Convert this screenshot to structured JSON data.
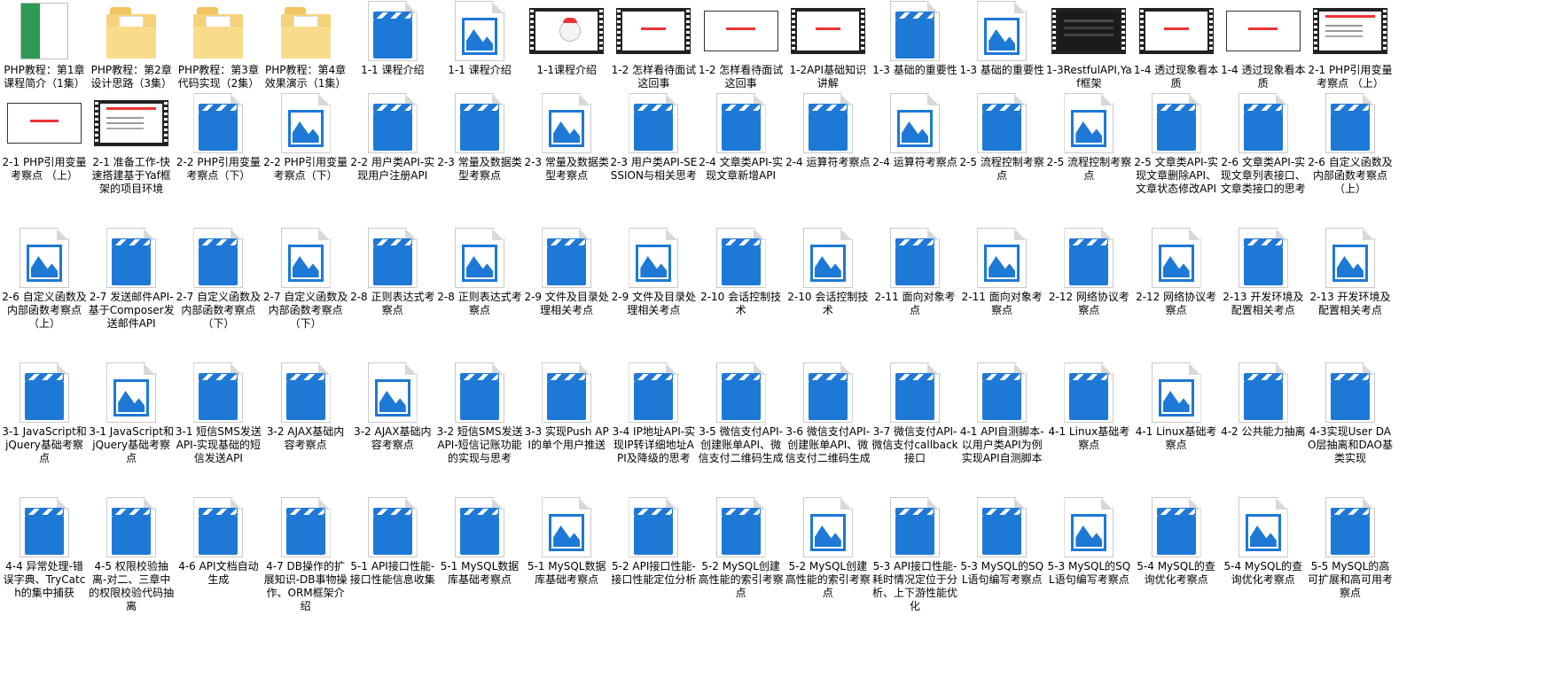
{
  "items": [
    {
      "label": "PHP教程：第1章课程简介（1集）",
      "kind": "book"
    },
    {
      "label": "PHP教程：第2章设计思路（3集）",
      "kind": "folder"
    },
    {
      "label": "PHP教程：第3章代码实现（2集）",
      "kind": "folder"
    },
    {
      "label": "PHP教程：第4章效果演示（1集）",
      "kind": "folder"
    },
    {
      "label": "1-1 课程介绍",
      "kind": "video"
    },
    {
      "label": "1-1 课程介绍",
      "kind": "image"
    },
    {
      "label": "1-1课程介绍",
      "kind": "film-mascot"
    },
    {
      "label": "1-2 怎样看待面试这回事",
      "kind": "film-red"
    },
    {
      "label": "1-2 怎样看待面试这回事",
      "kind": "slide-red"
    },
    {
      "label": "1-2API基础知识讲解",
      "kind": "film-red"
    },
    {
      "label": "1-3 基础的重要性",
      "kind": "video"
    },
    {
      "label": "1-3 基础的重要性",
      "kind": "image"
    },
    {
      "label": "1-3RestfulAPI,Yaf框架",
      "kind": "film-dark"
    },
    {
      "label": "1-4 透过现象看本质",
      "kind": "film-red"
    },
    {
      "label": "1-4 透过现象看本质",
      "kind": "slide-red"
    },
    {
      "label": "2-1 PHP引用变量考察点 （上）",
      "kind": "film-doc"
    },
    {
      "label": "2-1 PHP引用变量考察点 （上）",
      "kind": "slide-red"
    },
    {
      "label": "2-1 准备工作-快速搭建基于Yaf框架的项目环境",
      "kind": "film-doc"
    },
    {
      "label": "2-2 PHP引用变量考察点（下）",
      "kind": "video"
    },
    {
      "label": "2-2 PHP引用变量考察点（下）",
      "kind": "image"
    },
    {
      "label": "2-2 用户类API-实现用户注册API",
      "kind": "video"
    },
    {
      "label": "2-3 常量及数据类型考察点",
      "kind": "video"
    },
    {
      "label": "2-3 常量及数据类型考察点",
      "kind": "image"
    },
    {
      "label": "2-3 用户类API-SESSION与相关思考",
      "kind": "video"
    },
    {
      "label": "2-4 文章类API-实现文章新增API",
      "kind": "video"
    },
    {
      "label": "2-4 运算符考察点",
      "kind": "video"
    },
    {
      "label": "2-4 运算符考察点",
      "kind": "image"
    },
    {
      "label": "2-5 流程控制考察点",
      "kind": "video"
    },
    {
      "label": "2-5 流程控制考察点",
      "kind": "image"
    },
    {
      "label": "2-5 文章类API-实现文章删除API、文章状态修改API",
      "kind": "video"
    },
    {
      "label": "2-6 文章类API-实现文章列表接口、文章类接口的思考",
      "kind": "video"
    },
    {
      "label": "2-6 自定义函数及内部函数考察点（上）",
      "kind": "video"
    },
    {
      "label": "2-6 自定义函数及内部函数考察点（上）",
      "kind": "image"
    },
    {
      "label": "2-7 发送邮件API-基于Composer发送邮件API",
      "kind": "video"
    },
    {
      "label": "2-7 自定义函数及内部函数考察点（下）",
      "kind": "video"
    },
    {
      "label": "2-7 自定义函数及内部函数考察点（下）",
      "kind": "image"
    },
    {
      "label": "2-8 正则表达式考察点",
      "kind": "video"
    },
    {
      "label": "2-8 正则表达式考察点",
      "kind": "image"
    },
    {
      "label": "2-9 文件及目录处理相关考点",
      "kind": "video"
    },
    {
      "label": "2-9 文件及目录处理相关考点",
      "kind": "image"
    },
    {
      "label": "2-10 会话控制技术",
      "kind": "video"
    },
    {
      "label": "2-10 会话控制技术",
      "kind": "image"
    },
    {
      "label": "2-11 面向对象考点",
      "kind": "video"
    },
    {
      "label": "2-11 面向对象考察点",
      "kind": "image"
    },
    {
      "label": "2-12 网络协议考察点",
      "kind": "video"
    },
    {
      "label": "2-12 网络协议考察点",
      "kind": "image"
    },
    {
      "label": "2-13 开发环境及配置相关考点",
      "kind": "video"
    },
    {
      "label": "2-13 开发环境及配置相关考点",
      "kind": "image"
    },
    {
      "label": "3-1 JavaScript和jQuery基础考察点",
      "kind": "video"
    },
    {
      "label": "3-1 JavaScript和jQuery基础考察点",
      "kind": "image"
    },
    {
      "label": "3-1 短信SMS发送API-实现基础的短信发送API",
      "kind": "video"
    },
    {
      "label": "3-2 AJAX基础内容考察点",
      "kind": "video"
    },
    {
      "label": "3-2 AJAX基础内容考察点",
      "kind": "image"
    },
    {
      "label": "3-2 短信SMS发送API-短信记账功能的实现与思考",
      "kind": "video"
    },
    {
      "label": "3-3 实现Push API的单个用户推送",
      "kind": "video"
    },
    {
      "label": "3-4 IP地址API-实现IP转详细地址API及降级的思考",
      "kind": "video"
    },
    {
      "label": "3-5 微信支付API-创建账单API、微信支付二维码生成",
      "kind": "video"
    },
    {
      "label": "3-6 微信支付API-创建账单API、微信支付二维码生成",
      "kind": "video"
    },
    {
      "label": "3-7 微信支付API-微信支付callback接口",
      "kind": "video"
    },
    {
      "label": "4-1 API自测脚本-以用户类API为例实现API自测脚本",
      "kind": "video"
    },
    {
      "label": "4-1 Linux基础考察点",
      "kind": "video"
    },
    {
      "label": "4-1 Linux基础考察点",
      "kind": "image"
    },
    {
      "label": "4-2 公共能力抽离",
      "kind": "video"
    },
    {
      "label": "4-3实现User DAO层抽离和DAO基类实现",
      "kind": "video"
    },
    {
      "label": "4-4 异常处理-错误字典、TryCatch的集中捕获",
      "kind": "video"
    },
    {
      "label": "4-5 权限校验抽离-对二、三章中的权限校验代码抽离",
      "kind": "video"
    },
    {
      "label": "4-6 API文档自动生成",
      "kind": "video"
    },
    {
      "label": "4-7 DB操作的扩展知识-DB事物操作、ORM框架介绍",
      "kind": "video"
    },
    {
      "label": "5-1 API接口性能-接口性能信息收集",
      "kind": "video"
    },
    {
      "label": "5-1 MySQL数据库基础考察点",
      "kind": "video"
    },
    {
      "label": "5-1 MySQL数据库基础考察点",
      "kind": "image"
    },
    {
      "label": "5-2 API接口性能-接口性能定位分析",
      "kind": "video"
    },
    {
      "label": "5-2 MySQL创建高性能的索引考察点",
      "kind": "video"
    },
    {
      "label": "5-2 MySQL创建高性能的索引考察点",
      "kind": "image"
    },
    {
      "label": "5-3 API接口性能-耗时情况定位于分析、上下游性能优化",
      "kind": "video"
    },
    {
      "label": "5-3 MySQL的SQL语句编写考察点",
      "kind": "video"
    },
    {
      "label": "5-3 MySQL的SQL语句编写考察点",
      "kind": "image"
    },
    {
      "label": "5-4 MySQL的查询优化考察点",
      "kind": "video"
    },
    {
      "label": "5-4 MySQL的查询优化考察点",
      "kind": "image"
    },
    {
      "label": "5-5 MySQL的高可扩展和高可用考察点",
      "kind": "video"
    }
  ],
  "icon_names": {
    "video": "video-file-icon",
    "image": "image-file-icon",
    "folder": "folder-icon",
    "book": "book-cover-thumbnail",
    "film": "video-thumbnail",
    "slide": "slide-thumbnail"
  },
  "colors": {
    "accent": "#1e78d6",
    "folder": "#f5d27a",
    "book_green": "#2e9a55"
  }
}
